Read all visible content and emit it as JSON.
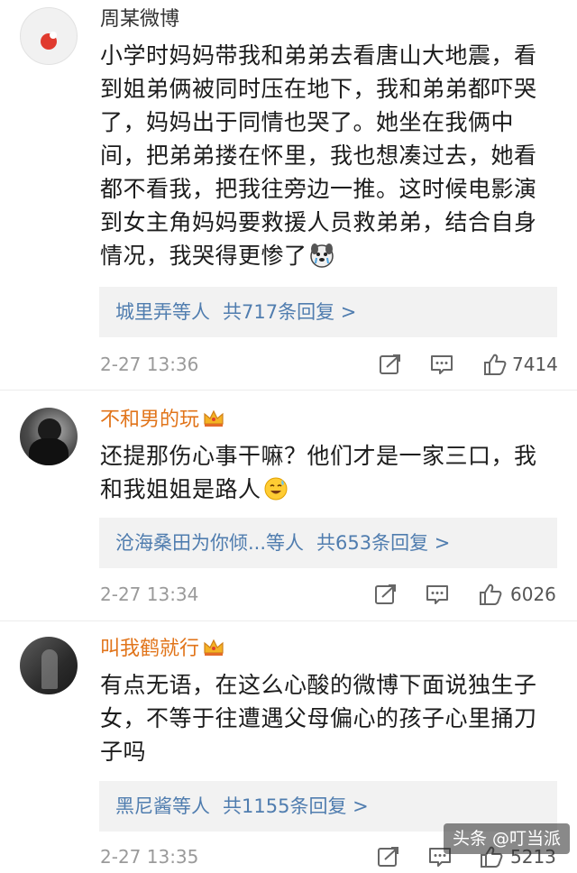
{
  "comments": [
    {
      "username": "周某微博",
      "text": "小学时妈妈带我和弟弟去看唐山大地震，看到姐弟俩被同时压在地下，我和弟弟都吓哭了，妈妈出于同情也哭了。她坐在我俩中间，把弟弟搂在怀里，我也想凑过去，她看都不看我，把我往旁边一推。这时候电影演到女主角妈妈要救援人员救弟弟，结合自身情况，我哭得更惨了",
      "emoji": "crying-dog-emoji",
      "reply_users": "城里弄等人",
      "reply_count": "共717条回复 >",
      "time": "2-27 13:36",
      "likes": "7414",
      "verified": false
    },
    {
      "username": "不和男的玩",
      "text": "还提那伤心事干嘛？他们才是一家三口，我和我姐姐是路人",
      "emoji": "sweat-smile-emoji",
      "reply_users": "沧海桑田为你倾...等人",
      "reply_count": "共653条回复 >",
      "time": "2-27 13:34",
      "likes": "6026",
      "verified": true
    },
    {
      "username": "叫我鹤就行",
      "text": "有点无语，在这么心酸的微博下面说独生子女，不等于往遭遇父母偏心的孩子心里捅刀子吗",
      "reply_users": "黑尼酱等人",
      "reply_count": "共1155条回复 >",
      "time": "2-27 13:35",
      "likes": "5213",
      "verified": true
    }
  ],
  "icons": {
    "repost": "repost-icon",
    "comment": "comment-icon",
    "like": "thumbs-up-icon",
    "vip": "crown-icon"
  },
  "colors": {
    "reply_link": "#507daf",
    "vip_name": "#e1741a",
    "reply_bg": "#f2f2f2"
  },
  "watermark": "头条 @叮当派"
}
